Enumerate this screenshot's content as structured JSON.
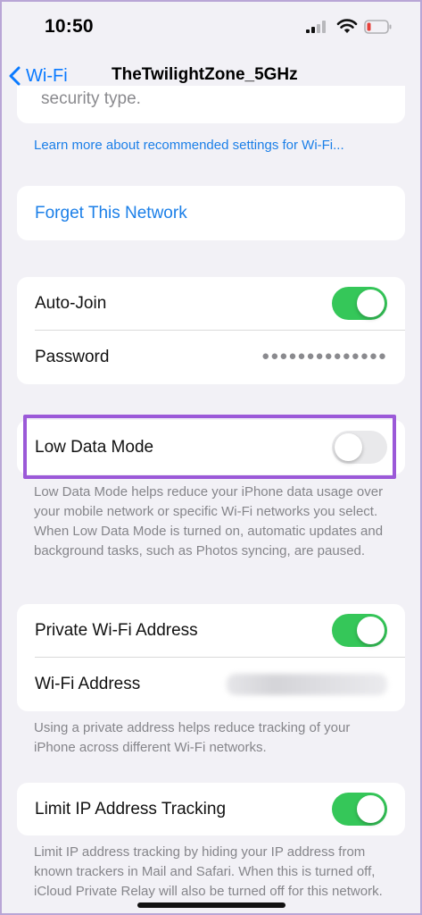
{
  "status_bar": {
    "time": "10:50",
    "battery_color": "#e5403a"
  },
  "nav": {
    "back_label": "Wi-Fi",
    "title": "TheTwilightZone_5GHz"
  },
  "top_section": {
    "cut_off_text": "security type.",
    "learn_more_link": "Learn more about recommended settings for Wi-Fi..."
  },
  "forget": {
    "label": "Forget This Network"
  },
  "join_group": {
    "auto_join_label": "Auto-Join",
    "auto_join_on": true,
    "password_label": "Password",
    "password_value": "●●●●●●●●●●●●●●"
  },
  "low_data": {
    "label": "Low Data Mode",
    "enabled": false,
    "description": "Low Data Mode helps reduce your iPhone data usage over your mobile network or specific Wi-Fi networks you select. When Low Data Mode is turned on, automatic updates and background tasks, such as Photos syncing, are paused."
  },
  "private_group": {
    "private_address_label": "Private Wi-Fi Address",
    "private_address_on": true,
    "wifi_address_label": "Wi-Fi Address",
    "description": "Using a private address helps reduce tracking of your iPhone across different Wi-Fi networks."
  },
  "limit_ip": {
    "label": "Limit IP Address Tracking",
    "enabled": true,
    "description": "Limit IP address tracking by hiding your IP address from known trackers in Mail and Safari. When this is turned off, iCloud Private Relay will also be turned off for this network."
  },
  "colors": {
    "accent": "#0a7aff",
    "toggle_on": "#35c759",
    "highlight": "#9b59d8",
    "background": "#f2f1f6"
  }
}
